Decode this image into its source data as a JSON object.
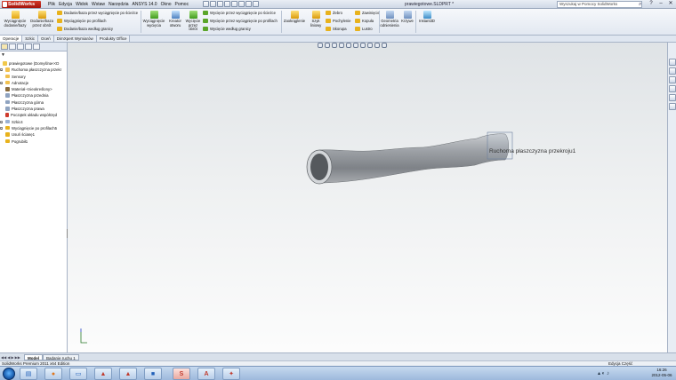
{
  "app": {
    "name": "SolidWorks",
    "document_title": "prawiegotowe.SLDPRT *"
  },
  "menu": [
    "Plik",
    "Edycja",
    "Widok",
    "Wstaw",
    "Narzędzia",
    "ANSYS 14.0",
    "Okno",
    "Pomoc"
  ],
  "search": {
    "placeholder": "Wyszukaj w Pomocy SolidWorks"
  },
  "ribbon": {
    "extrude_boss": "Wyciągnięcie dodanie/bazy",
    "revolve_boss": "Dodanie/baza przez obrót",
    "sweep_boss": "Dodanie/baza przez wyciągnięcie po ścieżce",
    "loft_boss": "Wyciągnięcie po profilach",
    "boundary_boss": "Dodanie/baza według granicy",
    "extrude_cut": "Wyciągnięcie wycięcia",
    "hole_wizard": "Kreator otworu",
    "revolve_cut": "Wycięcie przez obrót",
    "sweep_cut": "Wycięcie przez wyciągnięcie po ścieżce",
    "loft_cut": "Wycięcie przez wyciągnięcie po profilach",
    "boundary_cut": "Wycięcie według granicy",
    "fillet": "Zaokrąglenie",
    "linear_pattern": "Szyk liniowy",
    "rib": "Żebro",
    "draft": "Pochylenie",
    "shell": "Skorupa",
    "wrap": "Zawinięcie",
    "dome": "Kopuła",
    "mirror": "Lustro",
    "ref_geometry": "Geometria odniesienia",
    "curves": "Krzywe",
    "instant3d": "Instant3D"
  },
  "command_tabs": [
    "Operacje",
    "Szkic",
    "Oceń",
    "DimXpert Wymiarów",
    "Produkty Office"
  ],
  "feature_tree": [
    {
      "label": "prawiegotowe  (Domyślna<<D",
      "icon": "part-icon"
    },
    {
      "label": "Ruchoma płaszczyzna przekr",
      "icon": "folder-icon"
    },
    {
      "label": "Sensory",
      "icon": "sensor-icon"
    },
    {
      "label": "Adnotacje",
      "icon": "annotation-icon"
    },
    {
      "label": "Materiał <nieokreślony>",
      "icon": "material-icon"
    },
    {
      "label": "Płaszczyzna przednia",
      "icon": "plane-icon"
    },
    {
      "label": "Płaszczyzna górna",
      "icon": "plane-icon"
    },
    {
      "label": "Płaszczyzna prawa",
      "icon": "plane-icon"
    },
    {
      "label": "Początek układu współrzęd",
      "icon": "origin-icon"
    },
    {
      "label": "Szkic4",
      "icon": "sketch-icon"
    },
    {
      "label": "Wyciągnięcie po profilach5",
      "icon": "loft-icon"
    },
    {
      "label": "Usuń ścianę1",
      "icon": "delete-face-icon"
    },
    {
      "label": "Pogrubił1",
      "icon": "thicken-icon"
    }
  ],
  "viewport": {
    "section_plane_label": "Ruchoma płaszczyzna przekroju1"
  },
  "bottom_tabs": [
    "Model",
    "Badanie ruchu 1"
  ],
  "status": {
    "left": "SolidWorks Premium 2011 x64 Edition",
    "right": "Edycja Część"
  },
  "clock": {
    "time": "16:26",
    "date": "2012-05-06"
  }
}
